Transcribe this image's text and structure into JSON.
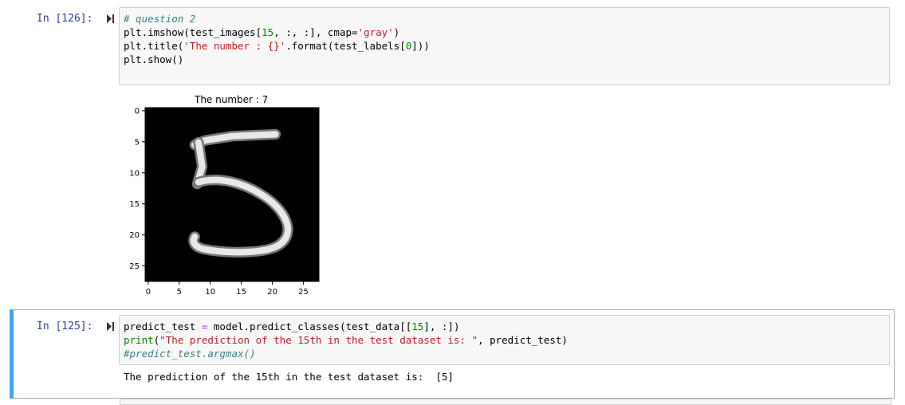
{
  "cells": [
    {
      "prompt": "In [126]:",
      "lines": [
        [
          {
            "t": "# question 2",
            "c": "cm-comment"
          }
        ],
        [
          {
            "t": "plt.imshow(test_images[",
            "c": ""
          },
          {
            "t": "15",
            "c": "cm-number"
          },
          {
            "t": ", :, :], cmap=",
            "c": ""
          },
          {
            "t": "'gray'",
            "c": "cm-string"
          },
          {
            "t": ")",
            "c": ""
          }
        ],
        [
          {
            "t": "plt.title(",
            "c": ""
          },
          {
            "t": "'The number : {}'",
            "c": "cm-string"
          },
          {
            "t": ".format(test_labels[",
            "c": ""
          },
          {
            "t": "0",
            "c": "cm-number"
          },
          {
            "t": "]))",
            "c": ""
          }
        ],
        [
          {
            "t": "plt.show()",
            "c": ""
          }
        ]
      ],
      "output_plot": {
        "title": "The number : 7",
        "y_ticks": [
          "0",
          "5",
          "10",
          "15",
          "20",
          "25"
        ],
        "x_ticks": [
          "0",
          "5",
          "10",
          "15",
          "20",
          "25"
        ]
      }
    },
    {
      "prompt": "In [125]:",
      "lines": [
        [
          {
            "t": "predict_test ",
            "c": ""
          },
          {
            "t": "=",
            "c": "cm-op"
          },
          {
            "t": " model.predict_classes(test_data[[",
            "c": ""
          },
          {
            "t": "15",
            "c": "cm-number"
          },
          {
            "t": "], :])",
            "c": ""
          }
        ],
        [
          {
            "t": "print",
            "c": "cm-number"
          },
          {
            "t": "(",
            "c": ""
          },
          {
            "t": "\"The prediction of the 15th in the test dataset is: \"",
            "c": "cm-string"
          },
          {
            "t": ", predict_test)",
            "c": ""
          }
        ],
        [
          {
            "t": "#predict_test.argmax()",
            "c": "cm-comment"
          }
        ]
      ],
      "output_text": "The prediction of the 15th in the test dataset is:  [5]"
    }
  ],
  "colors": {
    "prompt": "#303f9f",
    "selected_cell_border": "#42a5f5",
    "input_bg": "#f7f7f7"
  },
  "icons": {
    "run": "run-cell-icon"
  }
}
